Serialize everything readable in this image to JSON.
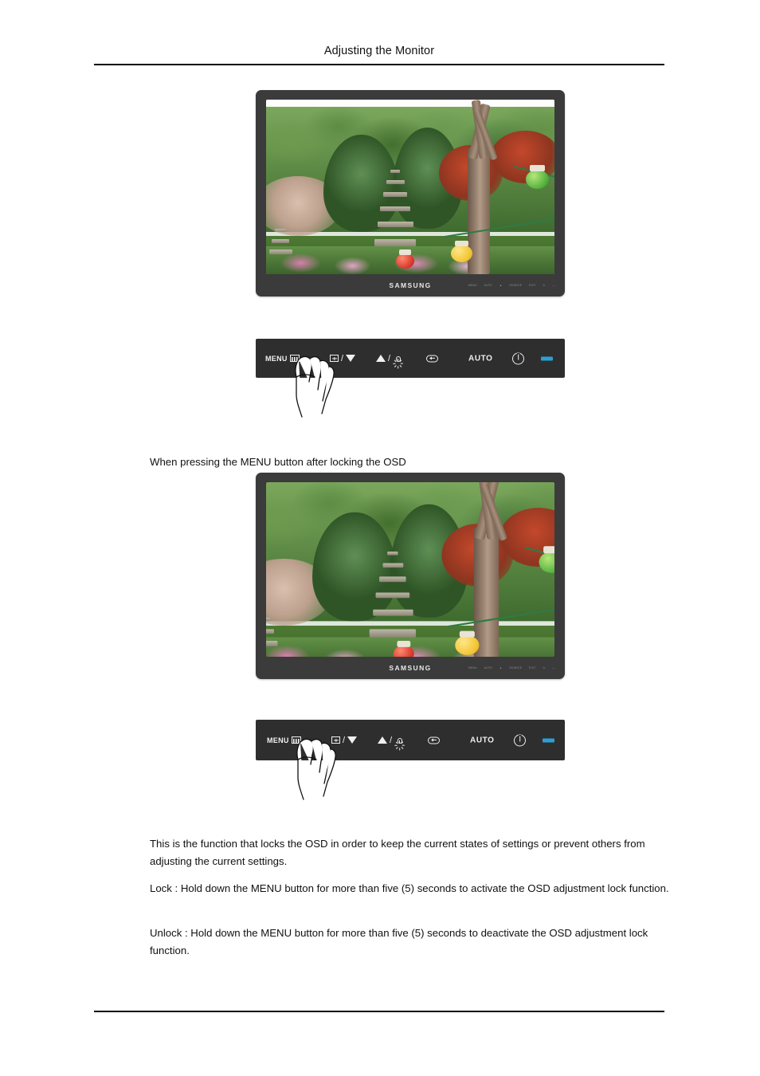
{
  "document": {
    "header_title": "Adjusting the Monitor"
  },
  "sections": {
    "caption": "When pressing the MENU button after locking the OSD",
    "paragraphs": [
      "This is the function that locks the OSD in order to keep the current states of settings or prevent others from adjusting the current settings.",
      "Lock : Hold down the MENU button for more than five (5) seconds to activate the OSD adjustment lock function.",
      "Unlock : Hold down the MENU button for more than five (5) seconds to deactivate the OSD adjustment lock function."
    ]
  },
  "monitor": {
    "brand": "SAMSUNG",
    "bezel_keys": [
      "MENU",
      "AUTO",
      "▲",
      "SOURCE",
      "EXIT",
      "⏻",
      "—"
    ],
    "screen_description": "Korean temple garden with stone pagoda, conifers, flowering azaleas and colored paper lanterns"
  },
  "control_panel": {
    "menu_label": "MENU",
    "auto_label": "AUTO",
    "buttons": [
      {
        "name": "menu",
        "label": "MENU",
        "icon": "menu-bars-icon"
      },
      {
        "name": "source-down",
        "label": "",
        "icon": "source-box-icon + down-triangle-icon"
      },
      {
        "name": "up-brightness",
        "label": "",
        "icon": "up-triangle-icon + brightness-sun-icon"
      },
      {
        "name": "enter",
        "label": "",
        "icon": "enter-pill-icon"
      },
      {
        "name": "auto",
        "label": "AUTO",
        "icon": ""
      },
      {
        "name": "power",
        "label": "",
        "icon": "power-icon"
      },
      {
        "name": "led",
        "label": "",
        "icon": "power-led-indicator"
      }
    ],
    "led_color": "#2b9fd4",
    "panel_color": "#2e2e2e"
  },
  "colors": {
    "page_background": "#ffffff",
    "text": "#111111",
    "rule": "#000000",
    "bezel": "#3b3b3b"
  }
}
